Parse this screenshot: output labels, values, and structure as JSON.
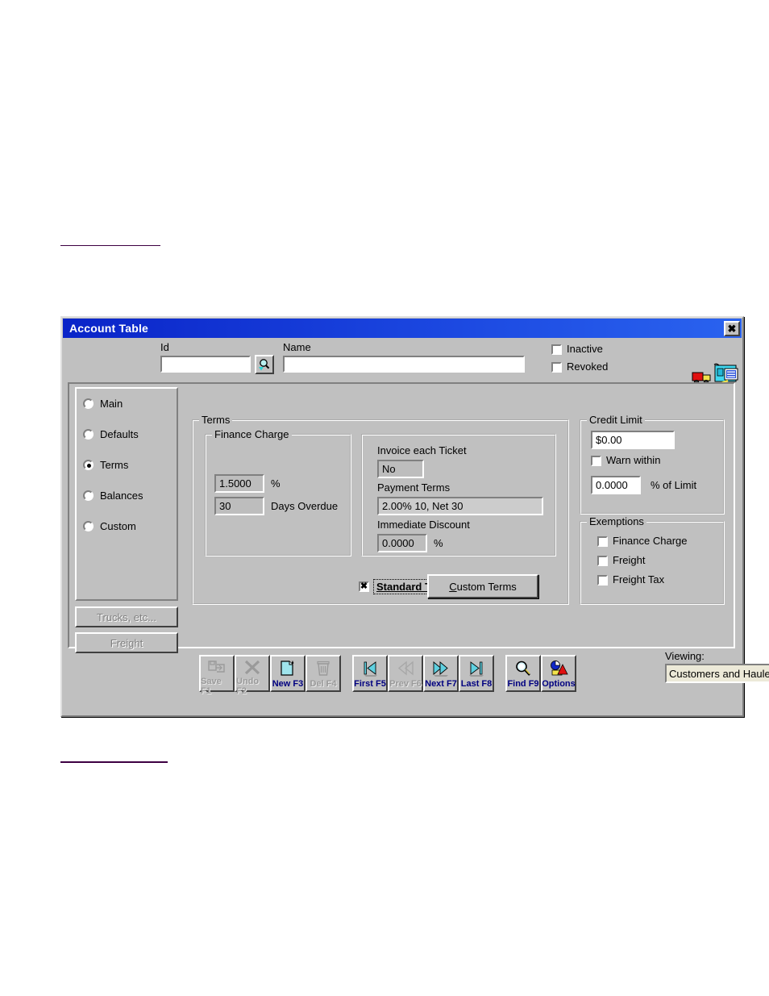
{
  "window": {
    "title": "Account Table",
    "close_label": "✖"
  },
  "header": {
    "id_label": "Id",
    "id_value": "",
    "name_label": "Name",
    "name_value": "",
    "find_icon": "magnifier-icon",
    "inactive_label": "Inactive",
    "inactive_checked": false,
    "revoked_label": "Revoked",
    "revoked_checked": false,
    "logo_icon": "truck-and-invoice-logo"
  },
  "nav": {
    "items": [
      {
        "label": "Main",
        "selected": false
      },
      {
        "label": "Defaults",
        "selected": false
      },
      {
        "label": "Terms",
        "selected": true
      },
      {
        "label": "Balances",
        "selected": false
      },
      {
        "label": "Custom",
        "selected": false
      }
    ],
    "buttons": [
      {
        "label": "Trucks, etc...",
        "enabled": false
      },
      {
        "label": "Freight",
        "enabled": false
      }
    ]
  },
  "terms": {
    "legend": "Terms",
    "finance_charge": {
      "legend": "Finance Charge",
      "rate_value": "1.5000",
      "rate_unit": "%",
      "days_value": "30",
      "days_label": "Days Overdue"
    },
    "invoice": {
      "invoice_each_ticket_label": "Invoice each Ticket",
      "invoice_each_ticket_value": "No",
      "payment_terms_label": "Payment Terms",
      "payment_terms_value": "2.00% 10, Net 30",
      "immediate_discount_label": "Immediate Discount",
      "immediate_discount_value": "0.0000",
      "immediate_discount_unit": "%"
    },
    "standard_terms_label": "Standard Terms",
    "standard_terms_checked": true,
    "standard_terms_mark": "✖",
    "custom_terms_button": "Custom Terms",
    "custom_terms_accel": "C"
  },
  "credit_limit": {
    "legend": "Credit Limit",
    "amount_value": "$0.00",
    "warn_within_label": "Warn within",
    "warn_within_checked": false,
    "percent_value": "0.0000",
    "percent_label": "% of Limit"
  },
  "exemptions": {
    "legend": "Exemptions",
    "items": [
      {
        "label": "Finance Charge",
        "checked": false
      },
      {
        "label": "Freight",
        "checked": false
      },
      {
        "label": "Freight Tax",
        "checked": false
      }
    ]
  },
  "toolbar": {
    "buttons": [
      {
        "label": "Save F1",
        "icon": "save-icon",
        "enabled": false
      },
      {
        "label": "Undo F2",
        "icon": "undo-x-icon",
        "enabled": false
      },
      {
        "label": "New F3",
        "icon": "new-page-icon",
        "enabled": true
      },
      {
        "label": "Del F4",
        "icon": "trash-icon",
        "enabled": false
      },
      {
        "label": "First F5",
        "icon": "first-arrow-icon",
        "enabled": true
      },
      {
        "label": "Prev F6",
        "icon": "prev-arrow-icon",
        "enabled": false
      },
      {
        "label": "Next F7",
        "icon": "next-arrow-icon",
        "enabled": true
      },
      {
        "label": "Last F8",
        "icon": "last-arrow-icon",
        "enabled": true
      },
      {
        "label": "Find F9",
        "icon": "magnifier-icon",
        "enabled": true
      },
      {
        "label": "Options",
        "icon": "options-shapes-icon",
        "enabled": true
      }
    ]
  },
  "viewing": {
    "label": "Viewing:",
    "value": "Customers and Haulers",
    "arrow": "▼"
  },
  "colors": {
    "titlebar": "#1b47e0",
    "face": "#c0c0c0",
    "rule": "#3d0042",
    "toolbar_text": "#000080"
  }
}
